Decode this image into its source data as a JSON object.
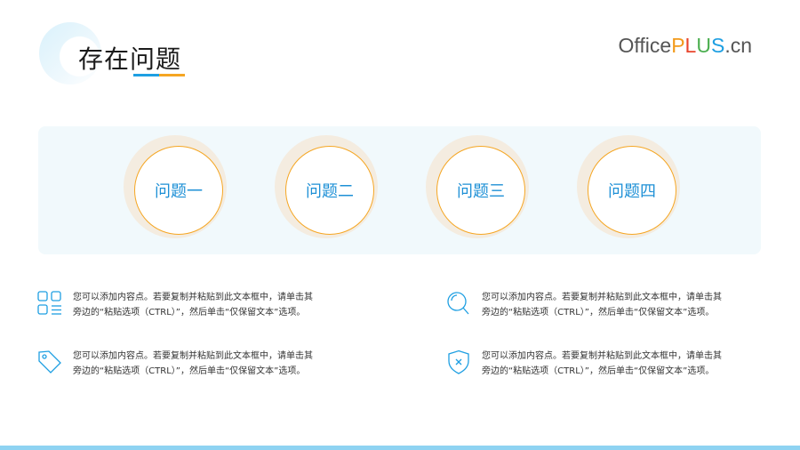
{
  "header": {
    "title": "存在问题",
    "logo_parts": [
      "Office",
      "P",
      "L",
      "U",
      "S",
      ".cn"
    ]
  },
  "problems": [
    {
      "label": "问题一"
    },
    {
      "label": "问题二"
    },
    {
      "label": "问题三"
    },
    {
      "label": "问题四"
    }
  ],
  "items": [
    {
      "icon": "grid-icon",
      "text": "您可以添加内容点。若要复制并粘贴到此文本框中，请单击其\n旁边的“粘贴选项（CTRL）”，然后单击“仅保留文本”选项。"
    },
    {
      "icon": "search-icon",
      "text": "您可以添加内容点。若要复制并粘贴到此文本框中，请单击其\n旁边的“粘贴选项（CTRL）”，然后单击“仅保留文本”选项。"
    },
    {
      "icon": "tag-icon",
      "text": "您可以添加内容点。若要复制并粘贴到此文本框中，请单击其\n旁边的“粘贴选项（CTRL）”，然后单击“仅保留文本”选项。"
    },
    {
      "icon": "shield-icon",
      "text": "您可以添加内容点。若要复制并粘贴到此文本框中，请单击其\n旁边的“粘贴选项（CTRL）”，然后单击“仅保留文本”选项。"
    }
  ],
  "colors": {
    "accent_blue": "#1e9fe2",
    "accent_orange": "#f5a623",
    "panel_bg": "#f1f9fc",
    "bottom_bar": "#8ed3f2"
  }
}
